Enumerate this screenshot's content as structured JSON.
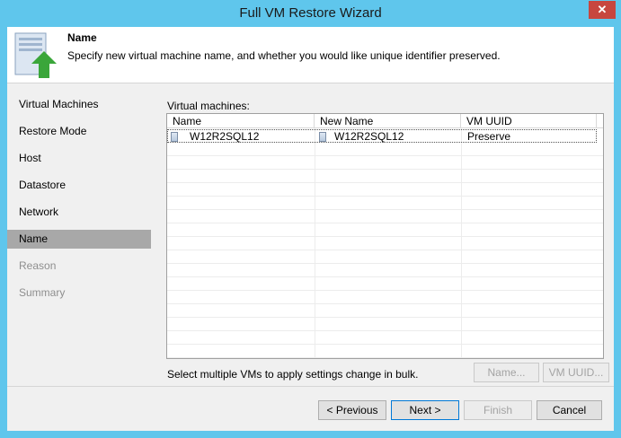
{
  "window": {
    "title": "Full VM Restore Wizard",
    "close_glyph": "✕"
  },
  "header": {
    "title": "Name",
    "description": "Specify new virtual machine name, and whether you would like unique identifier preserved.",
    "icon": "vm-restore-arrow-icon"
  },
  "nav": {
    "items": [
      {
        "label": "Virtual Machines",
        "state": "normal"
      },
      {
        "label": "Restore Mode",
        "state": "normal"
      },
      {
        "label": "Host",
        "state": "normal"
      },
      {
        "label": "Datastore",
        "state": "normal"
      },
      {
        "label": "Network",
        "state": "normal"
      },
      {
        "label": "Name",
        "state": "active"
      },
      {
        "label": "Reason",
        "state": "disabled"
      },
      {
        "label": "Summary",
        "state": "disabled"
      }
    ]
  },
  "grid": {
    "label": "Virtual machines:",
    "columns": [
      "Name",
      "New Name",
      "VM UUID"
    ],
    "rows": [
      {
        "name": "W12R2SQL12",
        "new_name": "W12R2SQL12",
        "uuid": "Preserve"
      }
    ]
  },
  "bulk": {
    "text": "Select multiple VMs to apply settings change in bulk.",
    "name_button": "Name...",
    "uuid_button": "VM UUID..."
  },
  "footer": {
    "previous": "< Previous",
    "next": "Next >",
    "finish": "Finish",
    "cancel": "Cancel"
  },
  "colors": {
    "titlebar": "#5fc6ec",
    "close": "#c7463f",
    "active_nav": "#a8a8a8",
    "arrow": "#3aa63a"
  }
}
